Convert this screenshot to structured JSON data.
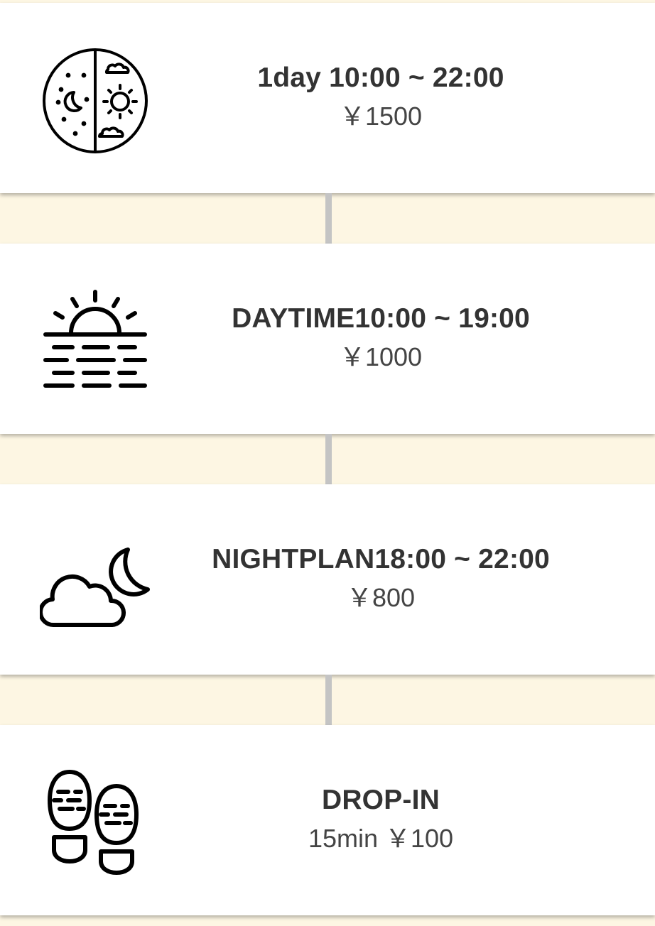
{
  "plans": [
    {
      "id": "oneday",
      "icon": "day-night-icon",
      "title": "1day 10:00 ~ 22:00",
      "price": "￥1500"
    },
    {
      "id": "daytime",
      "icon": "sunrise-icon",
      "title": "DAYTIME10:00 ~ 19:00",
      "price": "￥1000"
    },
    {
      "id": "night",
      "icon": "cloud-moon-icon",
      "title": "NIGHTPLAN18:00 ~ 22:00",
      "price": "￥800"
    },
    {
      "id": "dropin",
      "icon": "footprints-icon",
      "title": "DROP-IN",
      "price": "15min ￥100"
    }
  ],
  "colors": {
    "background": "#fdf6e3",
    "card": "#ffffff",
    "connector": "#c4c4c4",
    "text": "#333333"
  }
}
